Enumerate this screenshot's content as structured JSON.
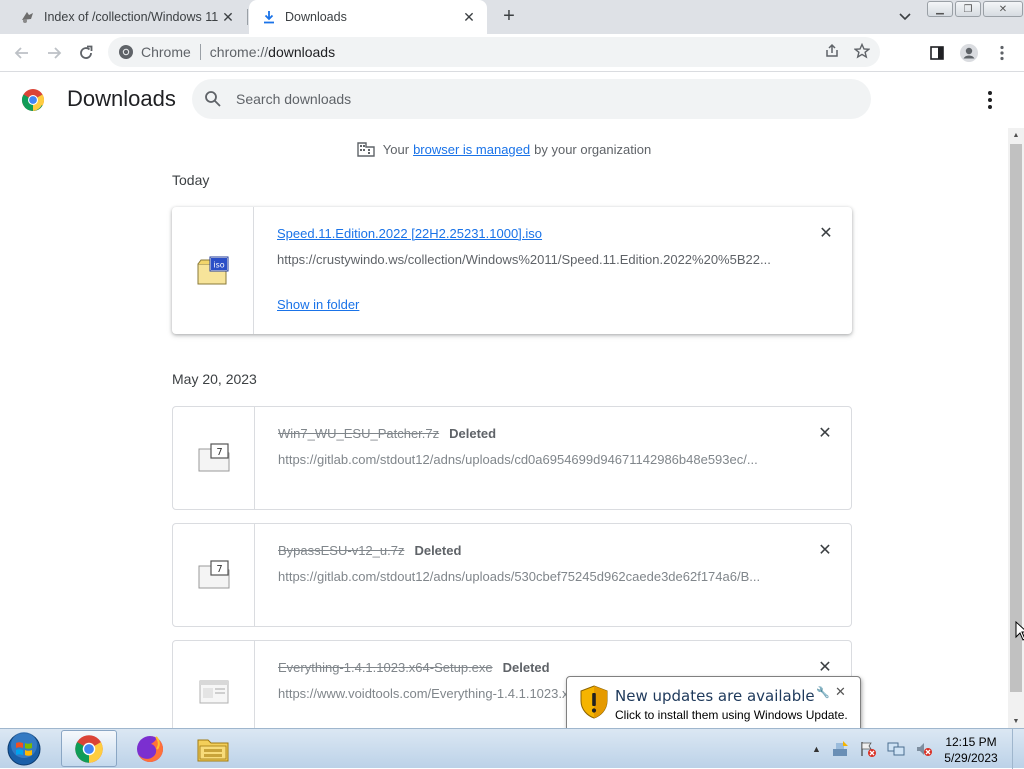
{
  "window": {
    "tabs": [
      {
        "label": "Index of /collection/Windows 11/",
        "active": false,
        "icon": "folder-bird-icon"
      },
      {
        "label": "Downloads",
        "active": true,
        "icon": "download-icon"
      }
    ],
    "new_tab": "+"
  },
  "toolbar": {
    "chip_label": "Chrome",
    "url_scheme": "chrome://",
    "url_path": "downloads"
  },
  "page": {
    "title": "Downloads",
    "search_placeholder": "Search downloads",
    "managed": {
      "prefix": "Your",
      "link": "browser is managed",
      "suffix": "by your organization"
    }
  },
  "groups": [
    {
      "date": "Today",
      "items": [
        {
          "filename": "Speed.11.Edition.2022 [22H2.25231.1000].iso",
          "url": "https://crustywindo.ws/collection/Windows%2011/Speed.11.Edition.2022%20%5B22...",
          "action": "Show in folder",
          "status": "",
          "file_icon": "iso-file-icon"
        }
      ]
    },
    {
      "date": "May 20, 2023",
      "items": [
        {
          "filename": "Win7_WU_ESU_Patcher.7z",
          "status": "Deleted",
          "url": "https://gitlab.com/stdout12/adns/uploads/cd0a6954699d94671142986b48e593ec/...",
          "file_icon": "7z-file-icon"
        },
        {
          "filename": "BypassESU-v12_u.7z",
          "status": "Deleted",
          "url": "https://gitlab.com/stdout12/adns/uploads/530cbef75245d962caede3de62f174a6/B...",
          "file_icon": "7z-file-icon"
        },
        {
          "filename": "Everything-1.4.1.1023.x64-Setup.exe",
          "status": "Deleted",
          "url": "https://www.voidtools.com/Everything-1.4.1.1023.x64-Setup.exe",
          "file_icon": "exe-file-icon"
        }
      ]
    }
  ],
  "notification": {
    "title": "New updates are available",
    "text": "Click to install them using Windows Update."
  },
  "taskbar": {
    "apps": [
      "chrome-icon",
      "firefox-icon",
      "explorer-icon"
    ],
    "time": "12:15 PM",
    "date": "5/29/2023"
  },
  "colors": {
    "link": "#1a73e8",
    "tabstrip": "#dee1e6",
    "omnibox": "#f1f3f4"
  }
}
